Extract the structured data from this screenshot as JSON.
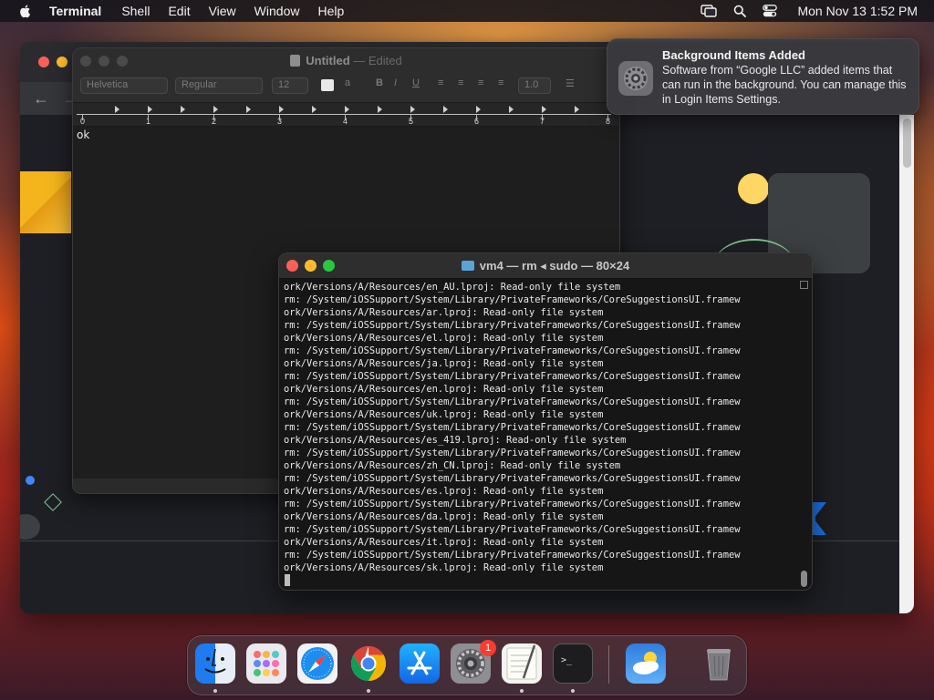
{
  "menubar": {
    "app_name": "Terminal",
    "menus": [
      "Shell",
      "Edit",
      "View",
      "Window",
      "Help"
    ],
    "clock": "Mon Nov 13  1:52 PM",
    "icons": [
      "apple-icon",
      "screen-mirroring-icon",
      "spotlight-search-icon",
      "control-center-icon"
    ]
  },
  "textedit": {
    "title": "Untitled",
    "title_suffix": "— Edited",
    "font_family": "Helvetica",
    "font_style": "Regular",
    "font_size": "12",
    "line_spacing": "1.0",
    "ruler_numbers": [
      "0",
      "1",
      "2",
      "3",
      "4",
      "5",
      "6",
      "7",
      "8"
    ],
    "body_text": "ok"
  },
  "notification": {
    "title": "Background Items Added",
    "body": "Software from “Google LLC” added items that can run in the background. You can manage this in Login Items Settings."
  },
  "terminal": {
    "title": "vm4 — rm ◂ sudo — 80×24",
    "lines": [
      "ork/Versions/A/Resources/en_AU.lproj: Read-only file system",
      "rm: /System/iOSSupport/System/Library/PrivateFrameworks/CoreSuggestionsUI.framew",
      "ork/Versions/A/Resources/ar.lproj: Read-only file system",
      "rm: /System/iOSSupport/System/Library/PrivateFrameworks/CoreSuggestionsUI.framew",
      "ork/Versions/A/Resources/el.lproj: Read-only file system",
      "rm: /System/iOSSupport/System/Library/PrivateFrameworks/CoreSuggestionsUI.framew",
      "ork/Versions/A/Resources/ja.lproj: Read-only file system",
      "rm: /System/iOSSupport/System/Library/PrivateFrameworks/CoreSuggestionsUI.framew",
      "ork/Versions/A/Resources/en.lproj: Read-only file system",
      "rm: /System/iOSSupport/System/Library/PrivateFrameworks/CoreSuggestionsUI.framew",
      "ork/Versions/A/Resources/uk.lproj: Read-only file system",
      "rm: /System/iOSSupport/System/Library/PrivateFrameworks/CoreSuggestionsUI.framew",
      "ork/Versions/A/Resources/es_419.lproj: Read-only file system",
      "rm: /System/iOSSupport/System/Library/PrivateFrameworks/CoreSuggestionsUI.framew",
      "ork/Versions/A/Resources/zh_CN.lproj: Read-only file system",
      "rm: /System/iOSSupport/System/Library/PrivateFrameworks/CoreSuggestionsUI.framew",
      "ork/Versions/A/Resources/es.lproj: Read-only file system",
      "rm: /System/iOSSupport/System/Library/PrivateFrameworks/CoreSuggestionsUI.framew",
      "ork/Versions/A/Resources/da.lproj: Read-only file system",
      "rm: /System/iOSSupport/System/Library/PrivateFrameworks/CoreSuggestionsUI.framew",
      "ork/Versions/A/Resources/it.lproj: Read-only file system",
      "rm: /System/iOSSupport/System/Library/PrivateFrameworks/CoreSuggestionsUI.framew",
      "ork/Versions/A/Resources/sk.lproj: Read-only file system"
    ]
  },
  "dock": {
    "apps": [
      {
        "name": "finder-icon",
        "running": true
      },
      {
        "name": "launchpad-icon",
        "running": false
      },
      {
        "name": "safari-icon",
        "running": false
      },
      {
        "name": "chrome-icon",
        "running": true
      },
      {
        "name": "app-store-icon",
        "running": false
      },
      {
        "name": "system-settings-icon",
        "running": false,
        "badge": "1"
      },
      {
        "name": "textedit-icon",
        "running": true
      },
      {
        "name": "terminal-icon",
        "running": true
      },
      {
        "name": "weather-icon",
        "running": false
      },
      {
        "name": "trash-icon",
        "running": false
      }
    ],
    "settings_badge": "1"
  },
  "colors": {
    "close": "#ff5f57",
    "minimize": "#febc2e",
    "zoom": "#28c840",
    "badge": "#ff3b30"
  }
}
